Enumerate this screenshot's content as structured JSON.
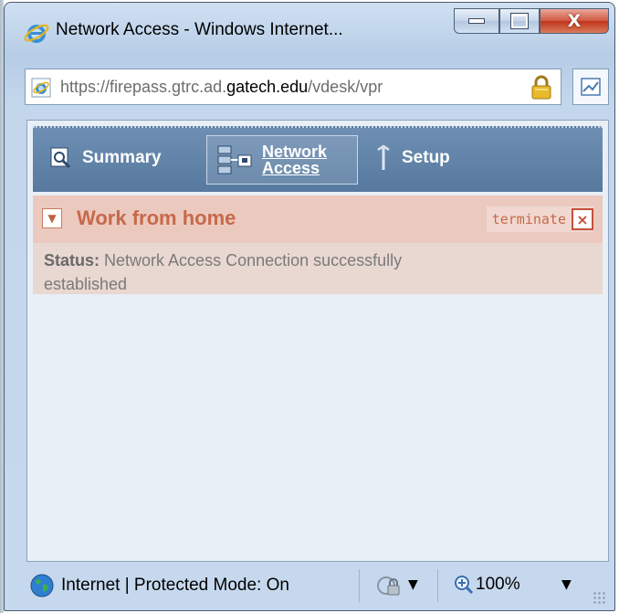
{
  "window": {
    "title": "Network Access - Windows Internet...",
    "controls": {
      "minimize": "minimize",
      "maximize": "maximize",
      "close": "close"
    }
  },
  "address": {
    "scheme": "https://",
    "subdomain": "firepass.gtrc.ad.",
    "host": "gatech.edu",
    "path": "/vdesk/vpr"
  },
  "nav": {
    "summary_label": "Summary",
    "network_line1": "Network",
    "network_line2": "Access",
    "setup_label": "Setup"
  },
  "panel": {
    "title": "Work from home",
    "terminate_label": "terminate",
    "terminate_x": "×",
    "status_label": "Status:",
    "status_text": "Network Access Connection successfully established"
  },
  "statusbar": {
    "zone_text": "Internet | Protected Mode: On",
    "zoom_text": "100%"
  },
  "colors": {
    "nav_bg": "#5f82a8",
    "panel_title": "#c56a4a",
    "panel_bg": "#e9d7d1"
  }
}
